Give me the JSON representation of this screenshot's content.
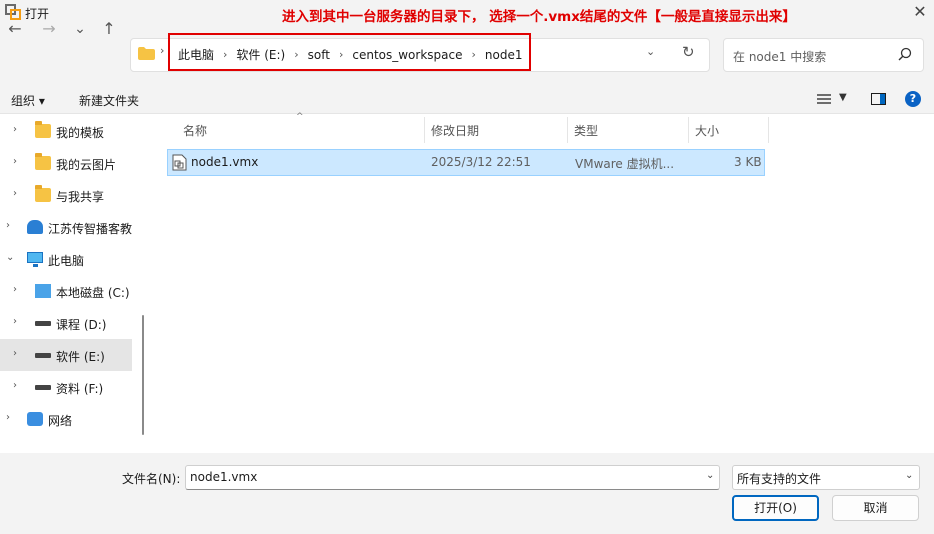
{
  "window": {
    "title": "打开",
    "annotation": "进入到其中一台服务器的目录下， 选择一个.vmx结尾的文件【一般是直接显示出来】",
    "close_glyph": "✕"
  },
  "nav": {
    "back": "←",
    "forward": "→",
    "recent": "⌄",
    "up": "↑",
    "breadcrumb": [
      "此电脑",
      "软件 (E:)",
      "soft",
      "centos_workspace",
      "node1"
    ],
    "search_placeholder": "在 node1 中搜索"
  },
  "toolbar": {
    "organize": "组织 ▾",
    "new_folder": "新建文件夹",
    "help": "?"
  },
  "sidebar": {
    "items": [
      {
        "label": "我的模板",
        "icon": "folder-icon",
        "expandable": true
      },
      {
        "label": "我的云图片",
        "icon": "folder-icon",
        "expandable": true
      },
      {
        "label": "与我共享",
        "icon": "folder-icon",
        "expandable": true
      },
      {
        "label": "江苏传智播客教",
        "icon": "cloud-drive-icon",
        "expandable": true
      },
      {
        "label": "此电脑",
        "icon": "computer-icon",
        "expanded": true
      },
      {
        "label": "本地磁盘 (C:)",
        "icon": "windows-drive-icon",
        "expandable": true
      },
      {
        "label": "课程 (D:)",
        "icon": "drive-icon",
        "expandable": true
      },
      {
        "label": "软件 (E:)",
        "icon": "drive-icon",
        "expandable": true,
        "selected": true
      },
      {
        "label": "资料 (F:)",
        "icon": "drive-icon",
        "expandable": true
      },
      {
        "label": "网络",
        "icon": "network-icon",
        "expandable": true
      }
    ]
  },
  "filelist": {
    "columns": [
      "名称",
      "修改日期",
      "类型",
      "大小"
    ],
    "rows": [
      {
        "name": "node1.vmx",
        "modified": "2025/3/12 22:51",
        "type": "VMware 虚拟机...",
        "size": "3 KB"
      }
    ]
  },
  "footer": {
    "filename_label": "文件名(N):",
    "filename_value": "node1.vmx",
    "filetype_value": "所有支持的文件",
    "open_button": "打开(O)",
    "cancel_button": "取消"
  },
  "colors": {
    "accent": "#0067c0",
    "selection": "#cce8ff",
    "annotation": "#e00000"
  }
}
